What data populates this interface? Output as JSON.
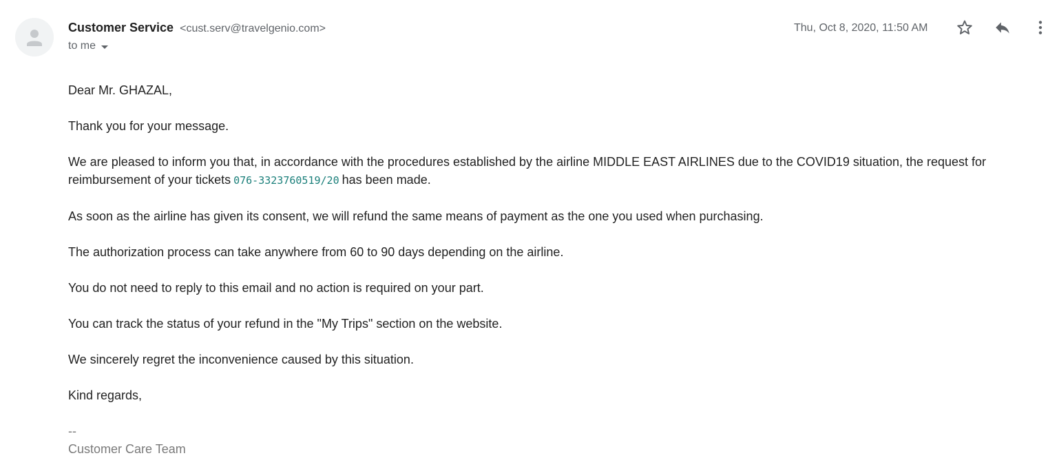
{
  "header": {
    "sender_name": "Customer Service",
    "sender_email": "<cust.serv@travelgenio.com>",
    "recipient": "to me",
    "timestamp": "Thu, Oct 8, 2020, 11:50 AM"
  },
  "icons": {
    "avatar": "person-avatar-icon",
    "star": "star-icon",
    "reply": "reply-icon",
    "more": "more-vert-icon",
    "caret": "chevron-down-icon"
  },
  "body": {
    "greeting": "Dear Mr. GHAZAL,",
    "p1": "Thank you for your message.",
    "p2_before": "We are pleased to inform you that, in accordance with the procedures established by the airline MIDDLE EAST AIRLINES due to the COVID19 situation, the request for reimbursement of your tickets",
    "ticket_number": "076-3323760519/20",
    "p2_after": "has been made.",
    "p3": "As soon as the airline has given its consent, we will refund the same means of payment as the one you used when purchasing.",
    "p4": "The authorization process can take anywhere from 60 to 90 days depending on the airline.",
    "p5": "You do not need to reply to this email and no action is required on your part.",
    "p6": "You can track the status of your refund in the \"My Trips\" section on the website.",
    "p7": "We sincerely regret the inconvenience caused by this situation.",
    "closing": "Kind regards,"
  },
  "signature": {
    "dash": "--",
    "team": "Customer Care Team"
  },
  "colors": {
    "ticket_link": "#1a7f7a",
    "muted": "#5f6368",
    "signature": "#7a7a7a"
  }
}
